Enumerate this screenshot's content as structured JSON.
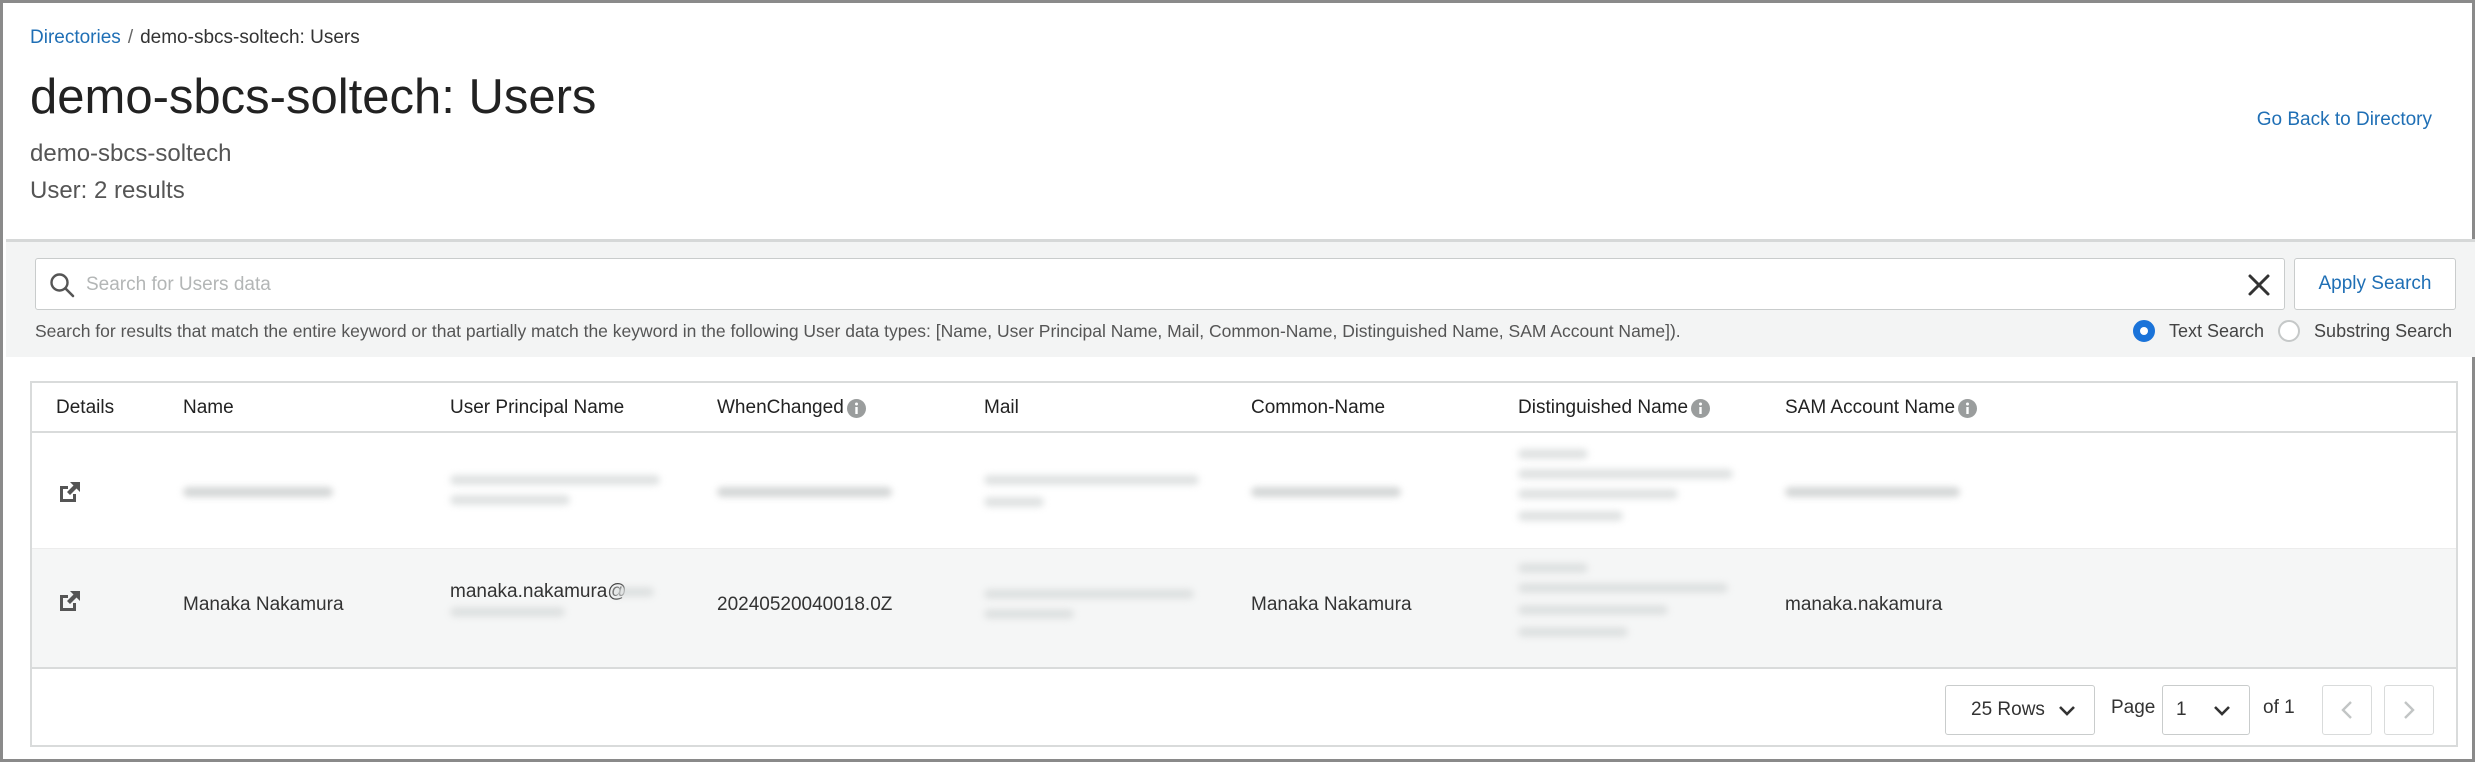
{
  "breadcrumb": {
    "root": "Directories",
    "separator": "/",
    "current": "demo-sbcs-soltech: Users"
  },
  "header": {
    "title": "demo-sbcs-soltech: Users",
    "subtitle": "demo-sbcs-soltech",
    "result_count": "User: 2 results",
    "go_back": "Go Back to Directory"
  },
  "search": {
    "placeholder": "Search for Users data",
    "value": "",
    "apply_label": "Apply Search",
    "help_text": "Search for results that match the entire keyword or that partially match the keyword in the following User data types: [Name, User Principal Name, Mail, Common-Name, Distinguished Name, SAM Account Name]).",
    "modes": [
      {
        "label": "Text Search",
        "selected": true
      },
      {
        "label": "Substring Search",
        "selected": false
      }
    ]
  },
  "table": {
    "columns": [
      "Details",
      "Name",
      "User Principal Name",
      "WhenChanged",
      "Mail",
      "Common-Name",
      "Distinguished Name",
      "SAM Account Name"
    ],
    "rows": [
      {
        "name": "",
        "upn": "",
        "when_changed": "",
        "mail": "",
        "common_name": "",
        "distinguished_name": "",
        "sam": "",
        "redacted": true
      },
      {
        "name": "Manaka Nakamura",
        "upn": "manaka.nakamura@",
        "when_changed": "20240520040018.0Z",
        "mail": "",
        "common_name": "Manaka Nakamura",
        "distinguished_name": "",
        "sam": "manaka.nakamura",
        "redacted": false
      }
    ]
  },
  "pagination": {
    "rows_per_page": "25 Rows",
    "page_label": "Page",
    "current_page": "1",
    "of_label": "of 1"
  },
  "colors": {
    "link": "#1f6fb5",
    "radio_selected": "#1a73d9",
    "panel_bg": "#f3f4f4",
    "border": "#d9dbdb"
  },
  "icons": [
    "search-icon",
    "close-icon",
    "external-link-icon",
    "info-icon",
    "chevron-down-icon",
    "chevron-left-icon",
    "chevron-right-icon"
  ]
}
